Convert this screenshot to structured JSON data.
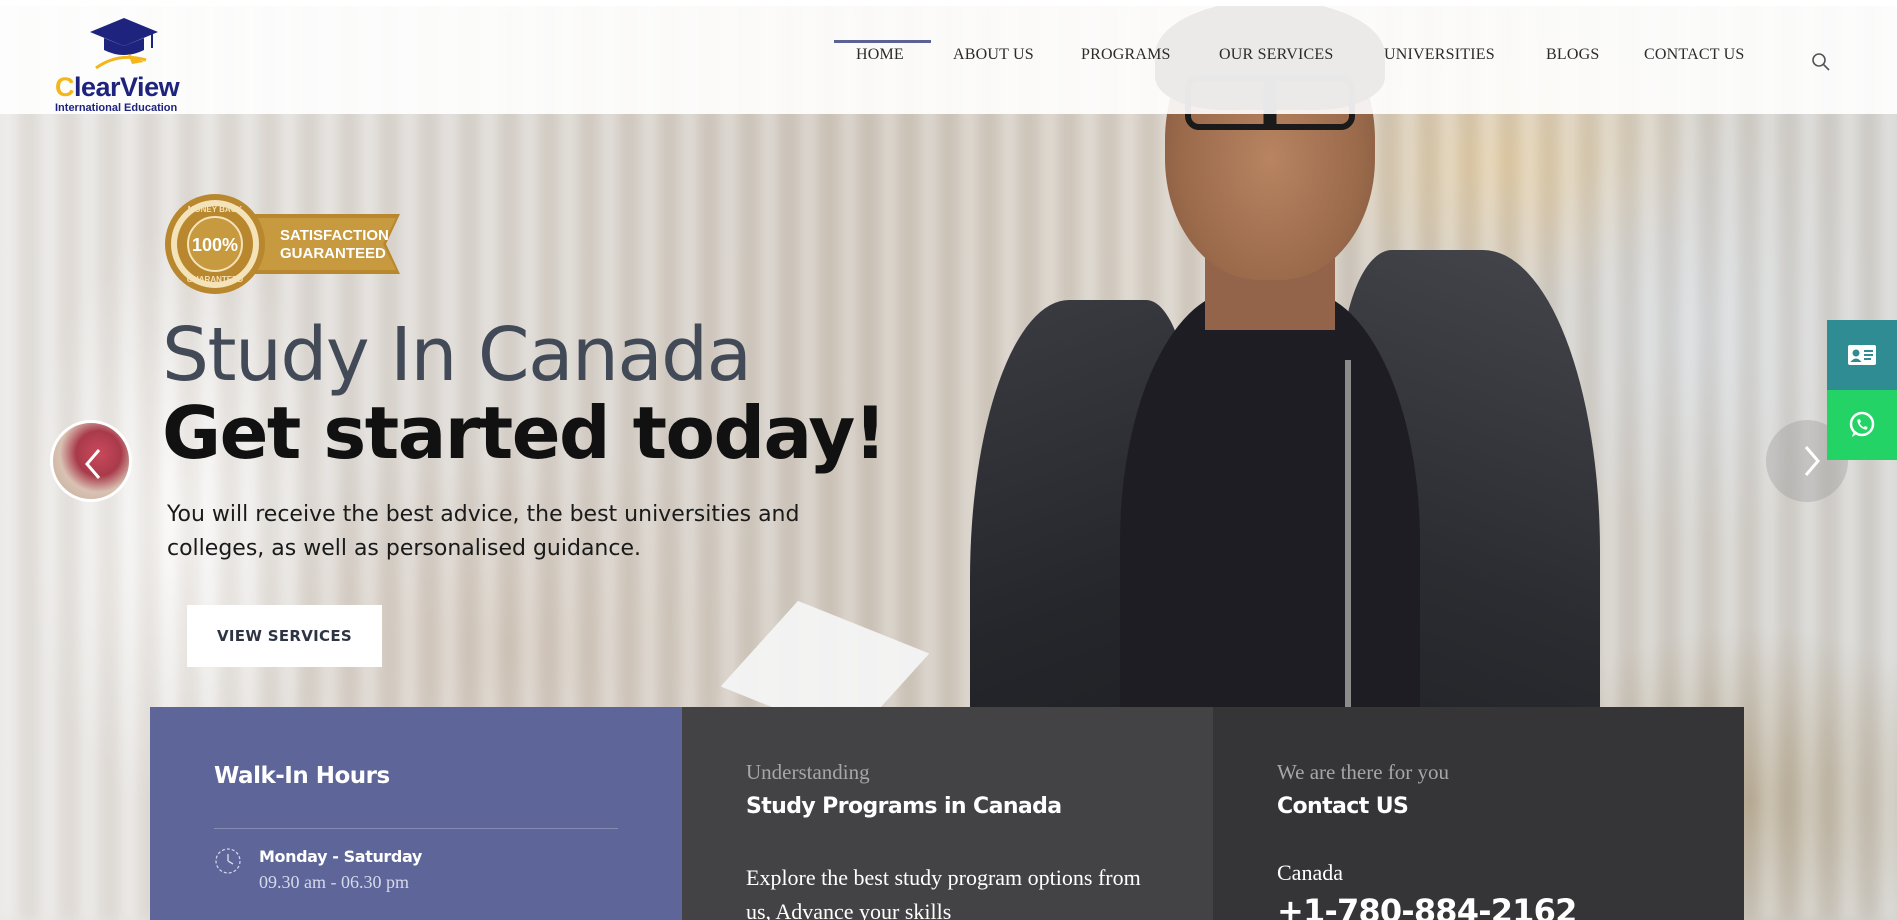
{
  "brand": {
    "name_first_letter": "C",
    "name_rest": "learView",
    "tagline": "International Education",
    "colors": {
      "navy": "#1e237e",
      "gold": "#f3b71b"
    }
  },
  "nav": {
    "items": [
      {
        "label": "HOME",
        "active": true
      },
      {
        "label": "ABOUT US"
      },
      {
        "label": "PROGRAMS"
      },
      {
        "label": "OUR SERVICES"
      },
      {
        "label": "UNIVERSITIES"
      },
      {
        "label": "BLOGS"
      },
      {
        "label": "CONTACT US"
      }
    ],
    "search_icon": "search-icon"
  },
  "hero": {
    "badge": {
      "ring_top": "MONEY BACK",
      "ring_bottom": "GUARANTEED",
      "center": "100%",
      "ribbon_line1": "SATISFACTION",
      "ribbon_line2": "GUARANTEED"
    },
    "title_line1": "Study In Canada",
    "title_line2": "Get started today!",
    "description": "You will receive the best advice, the best universities and colleges, as well as personalised guidance.",
    "cta_label": "VIEW SERVICES",
    "prev_icon": "chevron-left-icon",
    "next_icon": "chevron-right-icon"
  },
  "side_buttons": {
    "contact_icon": "contact-card-icon",
    "whatsapp_icon": "whatsapp-icon",
    "colors": {
      "contact": "#2f8c92",
      "whatsapp": "#23d366"
    }
  },
  "info_boxes": {
    "hours": {
      "title": "Walk-In Hours",
      "days": "Monday - Saturday",
      "time": "09.30 am - 06.30 pm",
      "icon": "clock-icon",
      "color": "#5d6599"
    },
    "programs": {
      "kicker": "Understanding",
      "heading": "Study Programs in Canada",
      "body": "Explore the best study program options from us, Advance your skills",
      "color": "#434345"
    },
    "contact": {
      "kicker": "We are there for you",
      "heading": "Contact US",
      "country": "Canada",
      "phone": "+1-780-884-2162",
      "color": "#353537"
    }
  }
}
